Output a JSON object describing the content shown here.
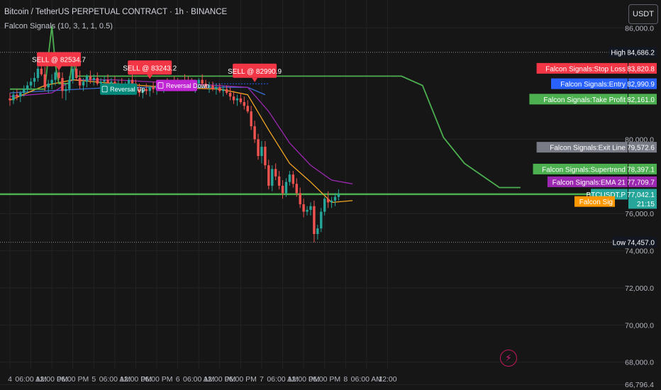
{
  "header": {
    "title": "Bitcoin / TetherUS PERPETUAL CONTRACT · 1h · BINANCE",
    "indicator": "Falcon Signals (10, 3, 1, 1, 0.5)",
    "currency": "USDT"
  },
  "colors": {
    "background": "#161616",
    "up": "#26a69a",
    "down": "#ef5350",
    "supertrend": "#4caf50",
    "ema": "#f5a623",
    "ema_slow": "#9c27b0",
    "baseline": "#3b6fd4",
    "axis_text": "#d1d4dc"
  },
  "chart_data": {
    "type": "candlestick",
    "interval": "1h",
    "ylim": [
      66500,
      87500
    ],
    "y_ticks": [
      "86,000.0",
      "80,000.0",
      "76,000.0",
      "74,000.0",
      "72,000.0",
      "70,000.0",
      "68,000.0",
      "66,796.4"
    ],
    "x_ticks": [
      "4",
      "06:00 AM",
      "12:00 PM",
      "06:00 PM",
      "5",
      "06:00 AM",
      "12:00 PM",
      "06:00 PM",
      "6",
      "06:00 AM",
      "12:00 PM",
      "06:00 PM",
      "7",
      "06:00 AM",
      "12:00 PM",
      "06:00 PM",
      "8",
      "06:00 AM",
      "12:00"
    ],
    "x_tick_index": [
      0,
      6,
      12,
      18,
      24,
      30,
      36,
      42,
      48,
      54,
      60,
      66,
      72,
      78,
      84,
      90,
      96,
      102,
      108
    ],
    "candles": [
      [
        82200,
        82500,
        81800,
        82100
      ],
      [
        82100,
        82600,
        81900,
        82400
      ],
      [
        82400,
        82700,
        82100,
        82300
      ],
      [
        82300,
        82600,
        82000,
        82500
      ],
      [
        82500,
        82900,
        82300,
        82700
      ],
      [
        82700,
        83100,
        82500,
        82900
      ],
      [
        82900,
        83300,
        82700,
        83100
      ],
      [
        83100,
        83600,
        82800,
        83300
      ],
      [
        83300,
        84000,
        83100,
        83800
      ],
      [
        83800,
        84300,
        83400,
        83500
      ],
      [
        83500,
        83900,
        82600,
        82800
      ],
      [
        82800,
        83200,
        82500,
        83000
      ],
      [
        83000,
        83500,
        82700,
        83200
      ],
      [
        83200,
        83700,
        82900,
        83600
      ],
      [
        83600,
        84100,
        83200,
        83300
      ],
      [
        83300,
        83600,
        82200,
        82600
      ],
      [
        82600,
        83000,
        82100,
        82700
      ],
      [
        82700,
        83400,
        82500,
        83200
      ],
      [
        83200,
        84500,
        83000,
        83800
      ],
      [
        83800,
        84100,
        83200,
        83300
      ],
      [
        83300,
        83700,
        82700,
        82900
      ],
      [
        82900,
        83300,
        82600,
        83100
      ],
      [
        83100,
        83500,
        82800,
        83400
      ],
      [
        83400,
        83700,
        83000,
        83200
      ],
      [
        83200,
        83500,
        82900,
        83300
      ],
      [
        83300,
        83600,
        82900,
        83000
      ],
      [
        83000,
        83300,
        82700,
        83100
      ],
      [
        83100,
        83400,
        82800,
        83200
      ],
      [
        83200,
        83500,
        82900,
        83000
      ],
      [
        83000,
        83300,
        82700,
        83100
      ],
      [
        83100,
        83400,
        82800,
        82900
      ],
      [
        82900,
        83200,
        82700,
        83000
      ],
      [
        83000,
        83300,
        82700,
        82800
      ],
      [
        82800,
        83100,
        82600,
        82900
      ],
      [
        82900,
        83300,
        82700,
        83200
      ],
      [
        83200,
        83500,
        82900,
        83000
      ],
      [
        83000,
        83200,
        82600,
        82700
      ],
      [
        82700,
        83000,
        82300,
        82500
      ],
      [
        82500,
        82800,
        82200,
        82700
      ],
      [
        82700,
        83000,
        82400,
        82600
      ],
      [
        82600,
        82900,
        82300,
        82800
      ],
      [
        82800,
        83100,
        82500,
        82700
      ],
      [
        82700,
        83000,
        82400,
        82900
      ],
      [
        82900,
        83200,
        82600,
        82800
      ],
      [
        82800,
        83100,
        82500,
        83000
      ],
      [
        83000,
        83300,
        82700,
        82900
      ],
      [
        82900,
        83200,
        82600,
        83100
      ],
      [
        83100,
        83400,
        82800,
        83000
      ],
      [
        83000,
        83300,
        82700,
        82900
      ],
      [
        82900,
        83200,
        82600,
        83200
      ],
      [
        83200,
        83500,
        82900,
        83100
      ],
      [
        83100,
        83400,
        82800,
        83000
      ],
      [
        83000,
        83300,
        82700,
        82800
      ],
      [
        82800,
        83100,
        82500,
        83000
      ],
      [
        83000,
        83300,
        82700,
        83200
      ],
      [
        83200,
        83500,
        82900,
        83000
      ],
      [
        83000,
        83200,
        82700,
        82800
      ],
      [
        82800,
        83100,
        82500,
        82900
      ],
      [
        82900,
        83100,
        82600,
        82700
      ],
      [
        82700,
        83000,
        82400,
        82800
      ],
      [
        82800,
        83000,
        82500,
        82600
      ],
      [
        82600,
        82900,
        82300,
        82700
      ],
      [
        82700,
        82900,
        82400,
        82500
      ],
      [
        82500,
        82800,
        82100,
        82300
      ],
      [
        82300,
        82600,
        81900,
        82100
      ],
      [
        82100,
        82400,
        81800,
        82200
      ],
      [
        82200,
        82500,
        81900,
        82000
      ],
      [
        82000,
        82300,
        81600,
        81800
      ],
      [
        81800,
        82100,
        81400,
        81500
      ],
      [
        81500,
        81800,
        80500,
        80700
      ],
      [
        80700,
        81000,
        79800,
        80000
      ],
      [
        80000,
        80300,
        78900,
        79100
      ],
      [
        79100,
        79900,
        78700,
        79600
      ],
      [
        79600,
        79900,
        78400,
        78600
      ],
      [
        78600,
        78900,
        77300,
        77500
      ],
      [
        77500,
        78600,
        77200,
        78400
      ],
      [
        78400,
        78700,
        77800,
        78000
      ],
      [
        78000,
        78300,
        77300,
        77500
      ],
      [
        77500,
        77800,
        76800,
        77100
      ],
      [
        77100,
        77900,
        76900,
        77700
      ],
      [
        77700,
        78300,
        77500,
        78100
      ],
      [
        78100,
        78300,
        77400,
        77600
      ],
      [
        77600,
        77900,
        76900,
        77100
      ],
      [
        77100,
        77400,
        76300,
        76500
      ],
      [
        76500,
        76800,
        75800,
        76100
      ],
      [
        76100,
        76400,
        75900,
        76200
      ],
      [
        76200,
        76600,
        75900,
        76400
      ],
      [
        76400,
        76700,
        74450,
        74900
      ],
      [
        74900,
        75400,
        74600,
        75200
      ],
      [
        75200,
        76300,
        75000,
        76100
      ],
      [
        76100,
        76900,
        75900,
        76800
      ],
      [
        76800,
        77200,
        76300,
        76600
      ],
      [
        76600,
        76900,
        76300,
        76700
      ],
      [
        76700,
        77100,
        76400,
        76900
      ],
      [
        76900,
        77300,
        76700,
        77040
      ]
    ],
    "supertrend": [
      [
        0,
        82700
      ],
      [
        10,
        82700
      ],
      [
        11,
        84500
      ],
      [
        12,
        86100
      ],
      [
        13,
        84000
      ],
      [
        14,
        83000
      ],
      [
        17,
        83000
      ],
      [
        18,
        84500
      ],
      [
        19,
        83400
      ],
      [
        107,
        83400
      ],
      [
        112,
        83400
      ],
      [
        118,
        82900
      ],
      [
        124,
        80100
      ],
      [
        130,
        78700
      ],
      [
        140,
        77400
      ],
      [
        146,
        77400
      ]
    ],
    "ema": [
      [
        0,
        82100
      ],
      [
        10,
        82900
      ],
      [
        18,
        83200
      ],
      [
        30,
        83000
      ],
      [
        45,
        82800
      ],
      [
        60,
        82700
      ],
      [
        68,
        82400
      ],
      [
        74,
        80500
      ],
      [
        80,
        78700
      ],
      [
        86,
        77700
      ],
      [
        92,
        76600
      ],
      [
        98,
        76700
      ]
    ],
    "ema_slow": [
      [
        0,
        82300
      ],
      [
        12,
        82500
      ],
      [
        18,
        83200
      ],
      [
        30,
        83200
      ],
      [
        50,
        83000
      ],
      [
        68,
        82800
      ],
      [
        74,
        81500
      ],
      [
        80,
        79800
      ],
      [
        86,
        78600
      ],
      [
        92,
        77800
      ],
      [
        98,
        77600
      ]
    ],
    "baseline": [
      [
        0,
        82500
      ],
      [
        30,
        82800
      ],
      [
        68,
        82800
      ],
      [
        73,
        82400
      ]
    ],
    "entry_level": 82990.9,
    "high_line": 84686.2,
    "low_line": 74457.0,
    "exit_level": 77042.1,
    "sell_signals": [
      {
        "label": "SELL @ 82534.7",
        "x": 14,
        "price": 83700
      },
      {
        "label": "SELL @ 83243.2",
        "x": 40,
        "price": 83250
      },
      {
        "label": "SELL @ 82990.9",
        "x": 70,
        "price": 83080
      }
    ],
    "reversal_signals": [
      {
        "label": "Reversal Up",
        "x": 27,
        "price": 82700,
        "type": "up"
      },
      {
        "label": "Reversal Down",
        "x": 43,
        "price": 82900,
        "type": "down"
      }
    ],
    "price_labels": [
      {
        "name": "",
        "value": "84,686.2",
        "price": 84686.2,
        "name_bg": "#131722",
        "value_bg": "#131722",
        "name_text": "High"
      },
      {
        "name": "Falcon Signals:Stop Loss",
        "value": "83,820.8",
        "price": 83820.8,
        "name_bg": "#f23645",
        "value_bg": "#f23645"
      },
      {
        "name": "Falcon Signals:Entry",
        "value": "82,990.9",
        "price": 82990.9,
        "name_bg": "#2962ff",
        "value_bg": "#2962ff"
      },
      {
        "name": "Falcon Signals:Take Profit",
        "value": "82,161.0",
        "price": 82161.0,
        "name_bg": "#4caf50",
        "value_bg": "#4caf50"
      },
      {
        "name": "Falcon Signals:Exit Line",
        "value": "79,572.6",
        "price": 79572.6,
        "name_bg": "#787b86",
        "value_bg": "#787b86"
      },
      {
        "name": "Falcon Signals:Supertrend",
        "value": "78,397.1",
        "price": 78397.1,
        "name_bg": "#4caf50",
        "value_bg": "#4caf50"
      },
      {
        "name": "Falcon Signals:EMA 21",
        "value": "77,709.7",
        "price": 77709.7,
        "name_bg": "#9c27b0",
        "value_bg": "#9c27b0"
      },
      {
        "name": "BTCUSDT.P",
        "value": "77,042.1",
        "price": 77042.1,
        "name_bg": "#26a69a",
        "value_bg": "#26a69a",
        "countdown": "21:15"
      },
      {
        "name": "Falcon Sig",
        "value": "",
        "price": 76650,
        "name_bg": "#ff9800",
        "value_bg": "#ff9800"
      },
      {
        "name": "",
        "value": "74,457.0",
        "price": 74457.0,
        "name_bg": "#131722",
        "value_bg": "#131722",
        "name_text": "Low"
      }
    ]
  }
}
